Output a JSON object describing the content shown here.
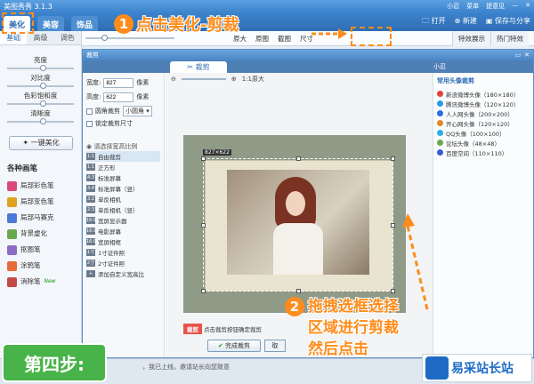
{
  "app": {
    "title": "美图秀秀 3.1.3",
    "user": "小忍",
    "menu": "菜单",
    "feedback": "提意见"
  },
  "main_tabs": [
    {
      "label": "美化",
      "active": true
    },
    {
      "label": "美容",
      "active": false
    },
    {
      "label": "饰品",
      "active": false
    }
  ],
  "toolbar_right": {
    "open": "打开",
    "new": "新建",
    "save_share": "保存与分享"
  },
  "left_panel": {
    "subtabs": [
      {
        "label": "基础",
        "active": true
      },
      {
        "label": "高级",
        "active": false
      },
      {
        "label": "调色",
        "active": false
      }
    ],
    "sliders": [
      {
        "label": "亮度",
        "value": 0.5
      },
      {
        "label": "对比度",
        "value": 0.5
      },
      {
        "label": "色彩饱和度",
        "value": 0.5
      },
      {
        "label": "清晰度",
        "value": 0.5
      }
    ],
    "beautify_button": "一键美化",
    "brush_title": "各种画笔",
    "brushes": [
      {
        "label": "局部彩色笔",
        "color": "#d94a7a",
        "is_new": false
      },
      {
        "label": "局部变色笔",
        "color": "#e0a020",
        "is_new": false
      },
      {
        "label": "局部马赛克",
        "color": "#4a7ad9",
        "is_new": false
      },
      {
        "label": "背景虚化",
        "color": "#6aa84f",
        "is_new": false
      },
      {
        "label": "抠图笔",
        "color": "#8e6cc4",
        "is_new": false
      },
      {
        "label": "涂鸦笔",
        "color": "#e86a3a",
        "is_new": false
      },
      {
        "label": "消除笔",
        "color": "#c44a4a",
        "is_new": true
      }
    ],
    "new_badge": "New"
  },
  "main_toolbar": {
    "zoom": "原大",
    "tools": [
      "原图",
      "截图",
      "尺寸"
    ],
    "right_tabs": [
      "特效展示",
      "热门特效"
    ]
  },
  "dialog": {
    "title": "裁剪",
    "tab": "裁剪",
    "user_label": "小忍",
    "width_label": "宽度:",
    "width_value": "827",
    "height_label": "高度:",
    "height_value": "622",
    "unit": "像素",
    "round_crop_label": "圆角裁剪",
    "round_crop_option": "小圆角",
    "lock_size_label": "锁定裁剪尺寸",
    "ratio_heading": "请选择宽高比例",
    "ratios": [
      {
        "icon": "1:1",
        "label": "自由裁剪",
        "selected": true
      },
      {
        "icon": "1:1",
        "label": "正方形",
        "selected": false
      },
      {
        "icon": "4:3",
        "label": "标准屏幕",
        "selected": false
      },
      {
        "icon": "3:4",
        "label": "标准屏幕（竖）",
        "selected": false
      },
      {
        "icon": "3:2",
        "label": "单反相机",
        "selected": false
      },
      {
        "icon": "2:3",
        "label": "单反相机（竖）",
        "selected": false
      },
      {
        "icon": "16:9",
        "label": "宽屏显示器",
        "selected": false
      },
      {
        "icon": "16:9",
        "label": "电影屏幕",
        "selected": false
      },
      {
        "icon": "16:9",
        "label": "宽屏相框",
        "selected": false
      },
      {
        "icon": "1寸",
        "label": "1寸证件照",
        "selected": false
      },
      {
        "icon": "2寸",
        "label": "2寸证件照",
        "selected": false
      },
      {
        "icon": "+",
        "label": "添加自定义宽高比",
        "selected": false
      }
    ],
    "canvas_zoom": "1:1原大",
    "crop_size_label": "827×622",
    "crop_tag": "裁剪",
    "crop_hint": "点击裁剪按钮确定裁剪",
    "finish_button": "完成裁剪",
    "cancel_button": "取"
  },
  "presets": {
    "title": "常用头像裁剪",
    "items": [
      {
        "label": "新浪微博头像（180×180）",
        "color": "#e0453a"
      },
      {
        "label": "腾讯微博头像（120×120）",
        "color": "#2a9be0"
      },
      {
        "label": "人人网头像（200×200）",
        "color": "#2a6ee0"
      },
      {
        "label": "开心网头像（120×120）",
        "color": "#e08a2a"
      },
      {
        "label": "QQ头像（100×100）",
        "color": "#2ab0e0"
      },
      {
        "label": "论坛头像（48×48）",
        "color": "#6aa84f"
      },
      {
        "label": "百度空间（110×110）",
        "color": "#3a5ad9"
      }
    ]
  },
  "status_bar": "，我已上线，邀请站长向您致意",
  "overlays": {
    "step1_num": "1",
    "step1_text": "点击美化-剪裁",
    "step2_num": "2",
    "step2_lines": [
      "拖拽选框选择",
      "区域进行剪裁",
      "然后点击"
    ],
    "step4_badge": "第四步:",
    "brand": "易采站长站",
    "accent": "#ff8c1a"
  }
}
